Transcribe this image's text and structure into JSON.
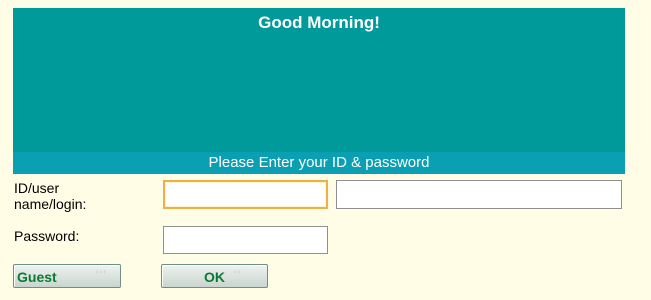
{
  "banner": {
    "greeting": "Good Morning!",
    "prompt": "Please Enter your ID & password"
  },
  "login": {
    "id_label": "ID/user name/login:",
    "password_label": "Password:",
    "id_value": "",
    "secondary_value": "",
    "password_value": ""
  },
  "buttons": {
    "guest_label": "Guest",
    "ok_label": "OK"
  },
  "colors": {
    "background": "#fffde6",
    "banner": "#009a9a",
    "prompt_bar": "#0a9fb2",
    "button_text": "#0b7a31",
    "focus_border": "#f0b048"
  }
}
